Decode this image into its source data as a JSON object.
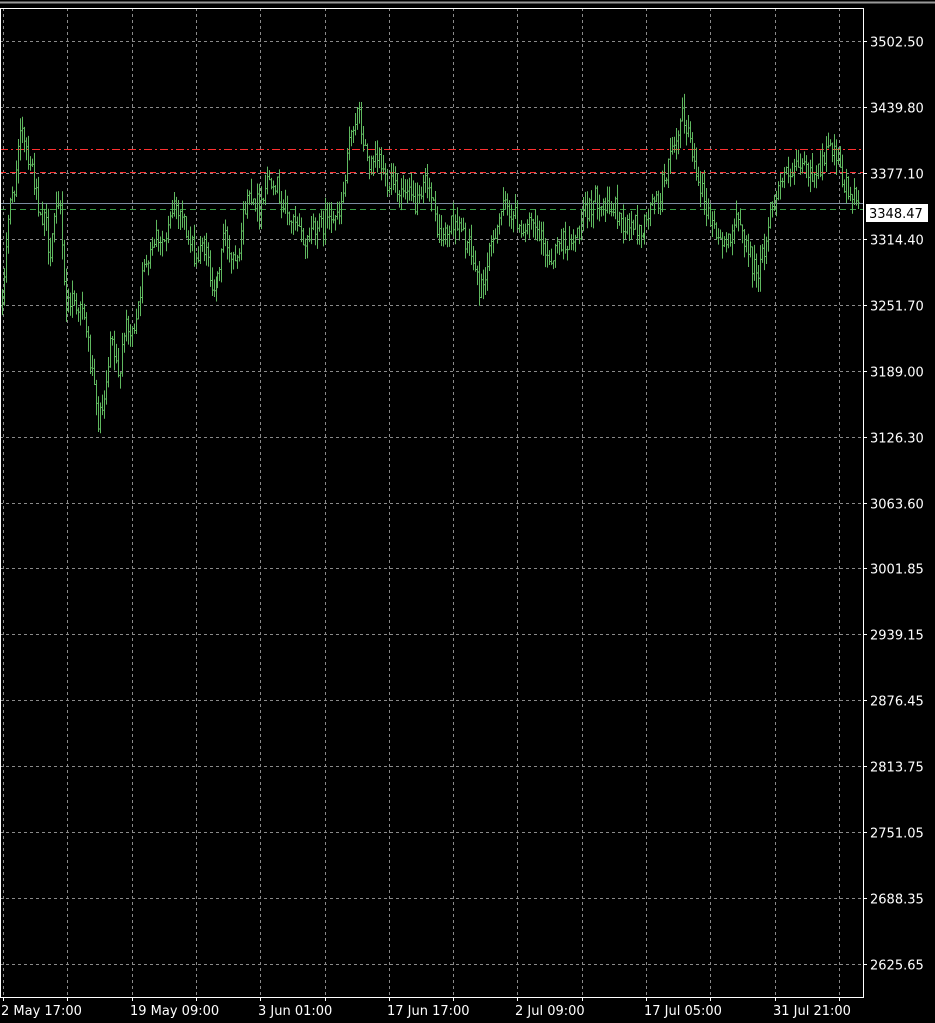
{
  "chart_data": {
    "type": "bar",
    "style": "ohlc-bars",
    "title": "",
    "background": "#000000",
    "bar_color": "#5fb85f",
    "grid": true,
    "grid_color": "#8a8a8a",
    "frame_color": "#ffffff",
    "ylim": [
      2594.225,
      3533.925
    ],
    "y_ticks": [
      "3502.50",
      "3439.80",
      "3377.10",
      "3314.40",
      "3251.70",
      "3189.00",
      "3126.30",
      "3063.60",
      "3001.85",
      "2939.15",
      "2876.45",
      "2813.75",
      "2751.05",
      "2688.35",
      "2625.65"
    ],
    "x_ticks": [
      "2 May 17:00",
      "19 May 09:00",
      "3 Jun 01:00",
      "17 Jun 17:00",
      "2 Jul 09:00",
      "17 Jul 05:00",
      "31 Jul 21:00"
    ],
    "current_price": "3348.47",
    "levels": [
      {
        "value": 3399.5,
        "style": "dash-dot",
        "color": "#ff3030"
      },
      {
        "value": 3378.0,
        "style": "dashed",
        "color": "#ff3030"
      },
      {
        "value": 3348.47,
        "style": "solid",
        "color": "#7a8aa0"
      },
      {
        "value": 3343.0,
        "style": "dashed",
        "color": "#3aa04a"
      }
    ],
    "series": [
      {
        "x_range": [
          "2 May 17:00",
          "31 Jul 21:00"
        ],
        "trace": [
          [
            0.0,
            3250
          ],
          [
            0.6,
            3330
          ],
          [
            1.7,
            3380
          ],
          [
            2.3,
            3425
          ],
          [
            3.0,
            3395
          ],
          [
            3.6,
            3380
          ],
          [
            4.3,
            3330
          ],
          [
            5.1,
            3330
          ],
          [
            5.5,
            3300
          ],
          [
            6.0,
            3330
          ],
          [
            6.8,
            3345
          ],
          [
            7.4,
            3250
          ],
          [
            8.0,
            3260
          ],
          [
            9.0,
            3250
          ],
          [
            9.8,
            3230
          ],
          [
            10.5,
            3180
          ],
          [
            11.2,
            3140
          ],
          [
            12.0,
            3160
          ],
          [
            12.7,
            3220
          ],
          [
            13.5,
            3180
          ],
          [
            14.2,
            3230
          ],
          [
            15.1,
            3220
          ],
          [
            15.9,
            3260
          ],
          [
            16.9,
            3300
          ],
          [
            17.9,
            3320
          ],
          [
            19.1,
            3310
          ],
          [
            20.0,
            3350
          ],
          [
            20.9,
            3340
          ],
          [
            21.8,
            3310
          ],
          [
            22.8,
            3295
          ],
          [
            23.5,
            3310
          ],
          [
            24.3,
            3280
          ],
          [
            25.0,
            3265
          ],
          [
            25.9,
            3320
          ],
          [
            26.8,
            3300
          ],
          [
            27.6,
            3305
          ],
          [
            28.5,
            3350
          ],
          [
            29.2,
            3360
          ],
          [
            30.0,
            3345
          ],
          [
            30.9,
            3370
          ],
          [
            31.7,
            3375
          ],
          [
            32.5,
            3355
          ],
          [
            33.1,
            3340
          ],
          [
            33.9,
            3330
          ],
          [
            34.7,
            3320
          ],
          [
            35.5,
            3310
          ],
          [
            36.4,
            3330
          ],
          [
            37.4,
            3325
          ],
          [
            38.3,
            3345
          ],
          [
            39.3,
            3330
          ],
          [
            40.1,
            3370
          ],
          [
            40.8,
            3420
          ],
          [
            41.6,
            3435
          ],
          [
            42.3,
            3400
          ],
          [
            43.2,
            3380
          ],
          [
            44.0,
            3390
          ],
          [
            44.9,
            3370
          ],
          [
            45.7,
            3375
          ],
          [
            46.4,
            3360
          ],
          [
            47.2,
            3355
          ],
          [
            48.0,
            3350
          ],
          [
            48.8,
            3345
          ],
          [
            49.6,
            3375
          ],
          [
            50.4,
            3340
          ],
          [
            51.2,
            3315
          ],
          [
            52.0,
            3320
          ],
          [
            52.8,
            3335
          ],
          [
            53.6,
            3320
          ],
          [
            54.4,
            3310
          ],
          [
            55.1,
            3290
          ],
          [
            55.8,
            3265
          ],
          [
            56.6,
            3285
          ],
          [
            57.4,
            3320
          ],
          [
            58.2,
            3340
          ],
          [
            59.0,
            3345
          ],
          [
            59.9,
            3335
          ],
          [
            60.8,
            3325
          ],
          [
            61.7,
            3325
          ],
          [
            62.5,
            3320
          ],
          [
            63.3,
            3305
          ],
          [
            64.1,
            3295
          ],
          [
            64.9,
            3310
          ],
          [
            65.7,
            3315
          ],
          [
            66.4,
            3305
          ],
          [
            67.2,
            3320
          ],
          [
            68.0,
            3335
          ],
          [
            68.9,
            3350
          ],
          [
            69.8,
            3355
          ],
          [
            70.7,
            3340
          ],
          [
            71.4,
            3345
          ],
          [
            72.1,
            3335
          ],
          [
            72.9,
            3325
          ],
          [
            73.7,
            3330
          ],
          [
            74.5,
            3320
          ],
          [
            75.2,
            3330
          ],
          [
            75.9,
            3345
          ],
          [
            76.7,
            3350
          ],
          [
            77.4,
            3375
          ],
          [
            78.1,
            3390
          ],
          [
            78.8,
            3400
          ],
          [
            79.4,
            3430
          ],
          [
            80.1,
            3420
          ],
          [
            80.7,
            3395
          ],
          [
            81.4,
            3375
          ],
          [
            82.1,
            3350
          ],
          [
            82.9,
            3330
          ],
          [
            83.6,
            3320
          ],
          [
            84.4,
            3305
          ],
          [
            85.2,
            3325
          ],
          [
            85.9,
            3330
          ],
          [
            86.6,
            3320
          ],
          [
            87.3,
            3300
          ],
          [
            87.9,
            3285
          ],
          [
            88.6,
            3290
          ],
          [
            89.2,
            3310
          ],
          [
            89.8,
            3345
          ],
          [
            90.5,
            3360
          ],
          [
            91.3,
            3375
          ],
          [
            92.1,
            3370
          ],
          [
            92.8,
            3380
          ],
          [
            93.6,
            3385
          ],
          [
            94.3,
            3375
          ],
          [
            95.0,
            3380
          ],
          [
            95.7,
            3385
          ],
          [
            96.4,
            3400
          ],
          [
            97.1,
            3395
          ],
          [
            97.7,
            3380
          ],
          [
            98.4,
            3365
          ],
          [
            99.2,
            3355
          ],
          [
            100.0,
            3348.47
          ]
        ]
      }
    ]
  }
}
